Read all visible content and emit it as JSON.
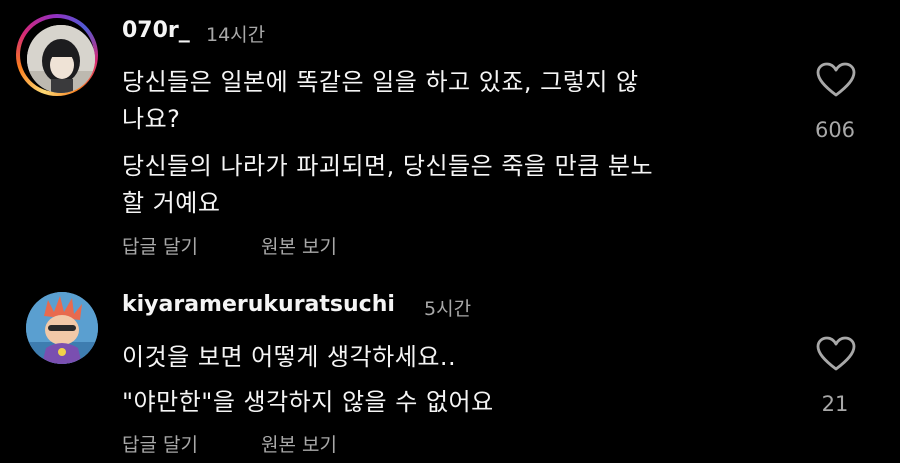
{
  "comments": [
    {
      "username": "070r_",
      "time": "14시간",
      "lines": [
        "당신들은 일본에 똑같은 일을 하고 있죠, 그렇지 않",
        "나요?",
        "당신들의 나라가 파괴되면, 당신들은 죽을 만큼 분노",
        "할 거예요"
      ],
      "reply_label": "답글 달기",
      "original_label": "원본 보기",
      "like_count": "606"
    },
    {
      "username": "kiyaramerukuratsuchi",
      "time": "5시간",
      "lines": [
        "이것을 보면 어떻게 생각하세요..",
        "\"야만한\"을 생각하지 않을 수 없어요"
      ],
      "reply_label": "답글 달기",
      "original_label": "원본 보기",
      "like_count": "21"
    }
  ],
  "colors": {
    "background": "#000000",
    "text": "#f5f5f5",
    "secondary": "#a8a8a8"
  }
}
